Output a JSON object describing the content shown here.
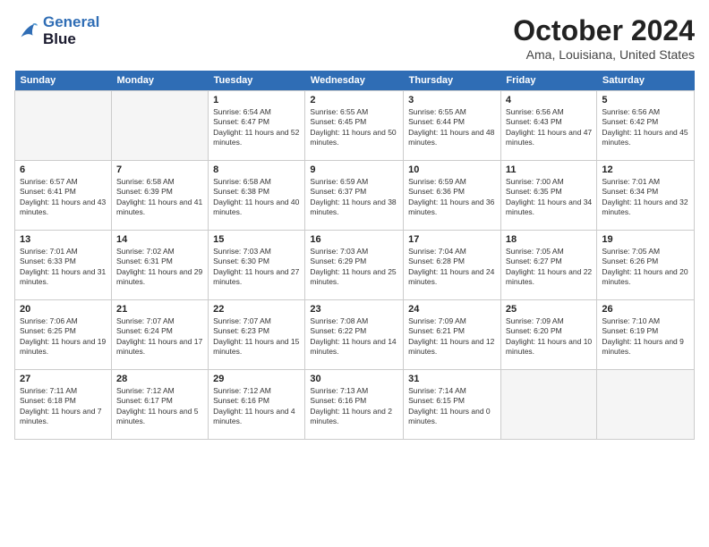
{
  "header": {
    "logo_line1": "General",
    "logo_line2": "Blue",
    "month": "October 2024",
    "location": "Ama, Louisiana, United States"
  },
  "weekdays": [
    "Sunday",
    "Monday",
    "Tuesday",
    "Wednesday",
    "Thursday",
    "Friday",
    "Saturday"
  ],
  "weeks": [
    [
      {
        "day": "",
        "empty": true
      },
      {
        "day": "",
        "empty": true
      },
      {
        "day": "1",
        "sunrise": "6:54 AM",
        "sunset": "6:47 PM",
        "daylight": "11 hours and 52 minutes."
      },
      {
        "day": "2",
        "sunrise": "6:55 AM",
        "sunset": "6:45 PM",
        "daylight": "11 hours and 50 minutes."
      },
      {
        "day": "3",
        "sunrise": "6:55 AM",
        "sunset": "6:44 PM",
        "daylight": "11 hours and 48 minutes."
      },
      {
        "day": "4",
        "sunrise": "6:56 AM",
        "sunset": "6:43 PM",
        "daylight": "11 hours and 47 minutes."
      },
      {
        "day": "5",
        "sunrise": "6:56 AM",
        "sunset": "6:42 PM",
        "daylight": "11 hours and 45 minutes."
      }
    ],
    [
      {
        "day": "6",
        "sunrise": "6:57 AM",
        "sunset": "6:41 PM",
        "daylight": "11 hours and 43 minutes."
      },
      {
        "day": "7",
        "sunrise": "6:58 AM",
        "sunset": "6:39 PM",
        "daylight": "11 hours and 41 minutes."
      },
      {
        "day": "8",
        "sunrise": "6:58 AM",
        "sunset": "6:38 PM",
        "daylight": "11 hours and 40 minutes."
      },
      {
        "day": "9",
        "sunrise": "6:59 AM",
        "sunset": "6:37 PM",
        "daylight": "11 hours and 38 minutes."
      },
      {
        "day": "10",
        "sunrise": "6:59 AM",
        "sunset": "6:36 PM",
        "daylight": "11 hours and 36 minutes."
      },
      {
        "day": "11",
        "sunrise": "7:00 AM",
        "sunset": "6:35 PM",
        "daylight": "11 hours and 34 minutes."
      },
      {
        "day": "12",
        "sunrise": "7:01 AM",
        "sunset": "6:34 PM",
        "daylight": "11 hours and 32 minutes."
      }
    ],
    [
      {
        "day": "13",
        "sunrise": "7:01 AM",
        "sunset": "6:33 PM",
        "daylight": "11 hours and 31 minutes."
      },
      {
        "day": "14",
        "sunrise": "7:02 AM",
        "sunset": "6:31 PM",
        "daylight": "11 hours and 29 minutes."
      },
      {
        "day": "15",
        "sunrise": "7:03 AM",
        "sunset": "6:30 PM",
        "daylight": "11 hours and 27 minutes."
      },
      {
        "day": "16",
        "sunrise": "7:03 AM",
        "sunset": "6:29 PM",
        "daylight": "11 hours and 25 minutes."
      },
      {
        "day": "17",
        "sunrise": "7:04 AM",
        "sunset": "6:28 PM",
        "daylight": "11 hours and 24 minutes."
      },
      {
        "day": "18",
        "sunrise": "7:05 AM",
        "sunset": "6:27 PM",
        "daylight": "11 hours and 22 minutes."
      },
      {
        "day": "19",
        "sunrise": "7:05 AM",
        "sunset": "6:26 PM",
        "daylight": "11 hours and 20 minutes."
      }
    ],
    [
      {
        "day": "20",
        "sunrise": "7:06 AM",
        "sunset": "6:25 PM",
        "daylight": "11 hours and 19 minutes."
      },
      {
        "day": "21",
        "sunrise": "7:07 AM",
        "sunset": "6:24 PM",
        "daylight": "11 hours and 17 minutes."
      },
      {
        "day": "22",
        "sunrise": "7:07 AM",
        "sunset": "6:23 PM",
        "daylight": "11 hours and 15 minutes."
      },
      {
        "day": "23",
        "sunrise": "7:08 AM",
        "sunset": "6:22 PM",
        "daylight": "11 hours and 14 minutes."
      },
      {
        "day": "24",
        "sunrise": "7:09 AM",
        "sunset": "6:21 PM",
        "daylight": "11 hours and 12 minutes."
      },
      {
        "day": "25",
        "sunrise": "7:09 AM",
        "sunset": "6:20 PM",
        "daylight": "11 hours and 10 minutes."
      },
      {
        "day": "26",
        "sunrise": "7:10 AM",
        "sunset": "6:19 PM",
        "daylight": "11 hours and 9 minutes."
      }
    ],
    [
      {
        "day": "27",
        "sunrise": "7:11 AM",
        "sunset": "6:18 PM",
        "daylight": "11 hours and 7 minutes."
      },
      {
        "day": "28",
        "sunrise": "7:12 AM",
        "sunset": "6:17 PM",
        "daylight": "11 hours and 5 minutes."
      },
      {
        "day": "29",
        "sunrise": "7:12 AM",
        "sunset": "6:16 PM",
        "daylight": "11 hours and 4 minutes."
      },
      {
        "day": "30",
        "sunrise": "7:13 AM",
        "sunset": "6:16 PM",
        "daylight": "11 hours and 2 minutes."
      },
      {
        "day": "31",
        "sunrise": "7:14 AM",
        "sunset": "6:15 PM",
        "daylight": "11 hours and 0 minutes."
      },
      {
        "day": "",
        "empty": true
      },
      {
        "day": "",
        "empty": true
      }
    ]
  ]
}
